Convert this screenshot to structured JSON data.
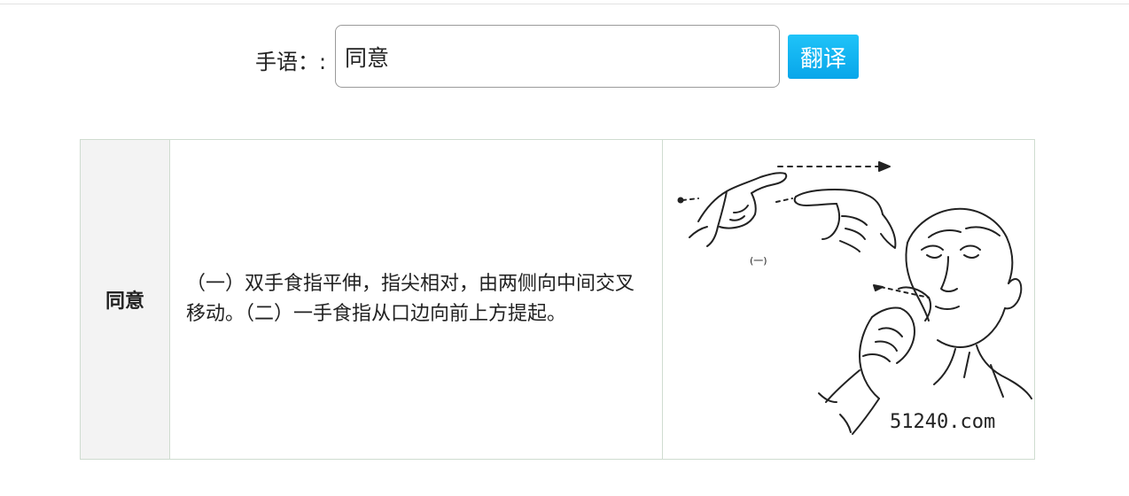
{
  "search": {
    "label": "手语：:",
    "value": "同意",
    "button_label": "翻译",
    "button_color": "#0bb0f0"
  },
  "result": {
    "word": "同意",
    "description": "（一）双手食指平伸，指尖相对，由两侧向中间交叉移动。（二）一手食指从口边向前上方提起。",
    "image": {
      "icon": "sign-language-illustration",
      "marker_label": "(一)",
      "watermark": "51240.com"
    }
  }
}
